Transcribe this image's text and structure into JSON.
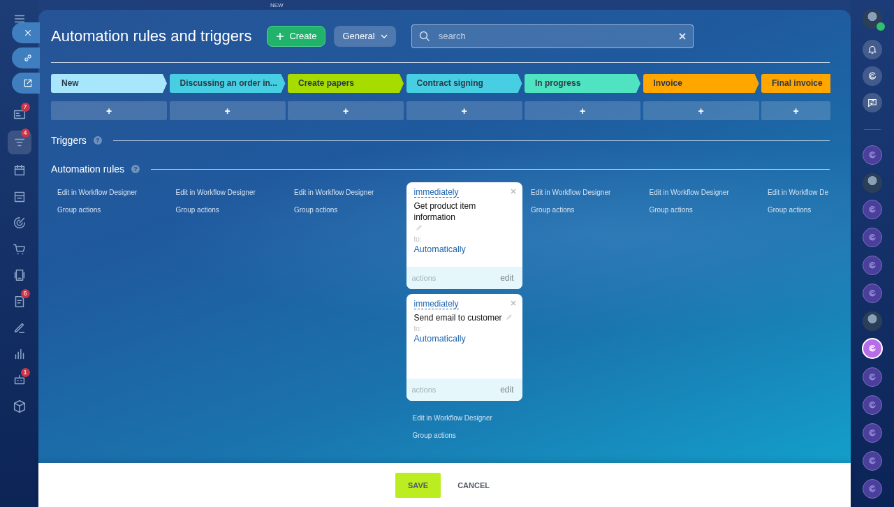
{
  "top_label": "NEW",
  "left_sidebar": {
    "items": [
      {
        "kind": "menu",
        "selected": false
      },
      {
        "kind": "card",
        "badge": "7",
        "selected": false
      },
      {
        "kind": "filter",
        "badge": "4",
        "selected": true
      },
      {
        "kind": "calendar",
        "selected": false
      },
      {
        "kind": "store",
        "selected": false
      },
      {
        "kind": "target",
        "selected": false
      },
      {
        "kind": "cart",
        "selected": false
      },
      {
        "kind": "phone",
        "selected": false
      },
      {
        "kind": "document",
        "badge": "6",
        "selected": false
      },
      {
        "kind": "pen",
        "selected": false
      },
      {
        "kind": "chart",
        "selected": false
      },
      {
        "kind": "bot",
        "badge": "1",
        "selected": false
      },
      {
        "kind": "box",
        "selected": false
      }
    ]
  },
  "slider_buttons": [
    {
      "kind": "close"
    },
    {
      "kind": "link"
    },
    {
      "kind": "external"
    }
  ],
  "header": {
    "title": "Automation rules and triggers",
    "create_button": "Create",
    "general_dropdown": "General",
    "search": {
      "placeholder": "search"
    }
  },
  "stages": [
    {
      "name": "New",
      "color": "#a8e6fb"
    },
    {
      "name": "Discussing an order in...",
      "color": "#47cee2"
    },
    {
      "name": "Create papers",
      "color": "#a6dc00"
    },
    {
      "name": "Contract signing",
      "color": "#47cee2"
    },
    {
      "name": "In progress",
      "color": "#4fe3c1"
    },
    {
      "name": "Invoice",
      "color": "#ffa600"
    },
    {
      "name": "Final invoice",
      "color": "#ffa600"
    }
  ],
  "add_stage_label": "+",
  "triggers": {
    "title": "Triggers",
    "help": "?"
  },
  "automation_rules": {
    "title": "Automation rules",
    "help": "?"
  },
  "columns": [
    {
      "links": [
        "Edit in Workflow Designer",
        "Group actions"
      ]
    },
    {
      "links": [
        "Edit in Workflow Designer",
        "Group actions"
      ]
    },
    {
      "links": [
        "Edit in Workflow Designer",
        "Group actions"
      ]
    },
    {
      "rules": [
        {
          "delay": "immediately",
          "title": "Get product item information",
          "to_label": "to:",
          "to_value": "Automatically",
          "actions": "actions",
          "edit": "edit"
        },
        {
          "delay": "immediately",
          "title": "Send email to customer",
          "to_label": "to:",
          "to_value": "Automatically",
          "actions": "actions",
          "edit": "edit"
        }
      ],
      "links": [
        "Edit in Workflow Designer",
        "Group actions"
      ]
    },
    {
      "links": [
        "Edit in Workflow Designer",
        "Group actions"
      ]
    },
    {
      "links": [
        "Edit in Workflow Designer",
        "Group actions"
      ]
    },
    {
      "links": [
        "Edit in Workflow De",
        "Group actions"
      ]
    }
  ],
  "footer": {
    "save": "SAVE",
    "cancel": "CANCEL"
  },
  "right_sidebar": {
    "top": [
      {
        "kind": "avatar"
      },
      {
        "kind": "bell"
      },
      {
        "kind": "logo"
      },
      {
        "kind": "swap"
      }
    ],
    "chats": [
      {
        "kind": "channel",
        "selected": false
      },
      {
        "kind": "avatar",
        "selected": false
      },
      {
        "kind": "channel",
        "selected": false
      },
      {
        "kind": "channel",
        "selected": false
      },
      {
        "kind": "channel",
        "selected": false
      },
      {
        "kind": "channel",
        "selected": false
      },
      {
        "kind": "avatar",
        "selected": false
      },
      {
        "kind": "channel",
        "selected": true
      },
      {
        "kind": "channel",
        "selected": false
      },
      {
        "kind": "channel",
        "selected": false
      },
      {
        "kind": "channel",
        "selected": false
      },
      {
        "kind": "channel",
        "selected": false
      },
      {
        "kind": "channel",
        "selected": false
      }
    ]
  }
}
